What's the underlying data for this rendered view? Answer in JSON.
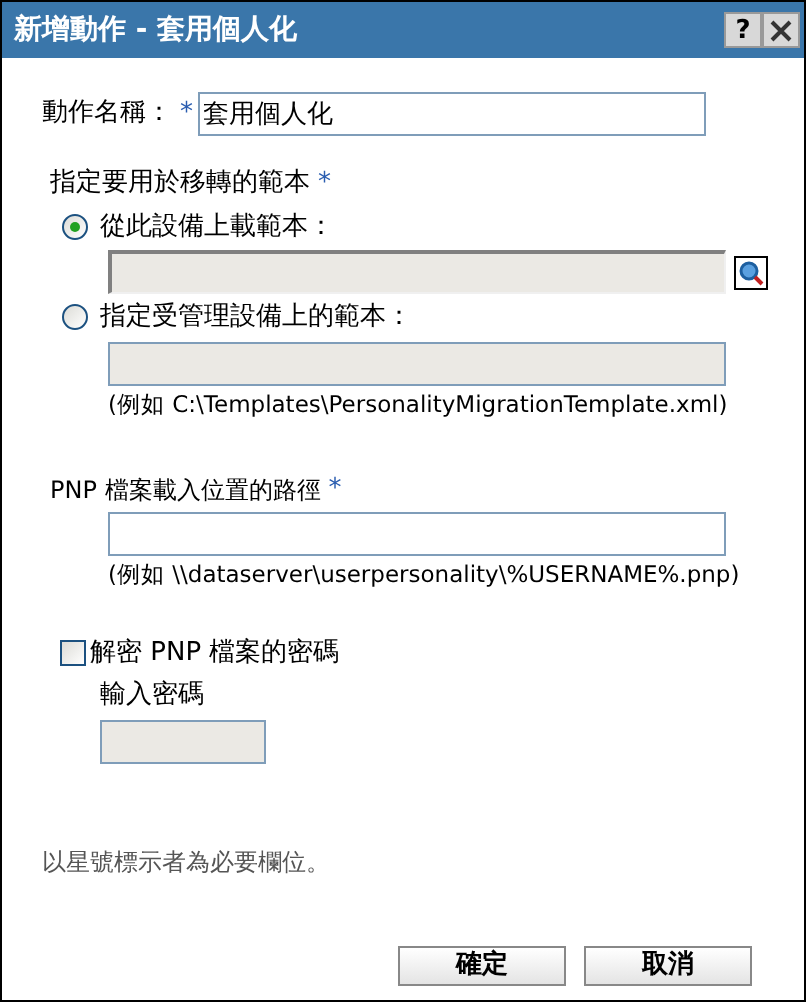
{
  "window": {
    "title": "新增動作 - 套用個人化",
    "help": "?"
  },
  "action_name": {
    "label": "動作名稱：",
    "required_mark": "*",
    "value": "套用個人化"
  },
  "template": {
    "label": "指定要用於移轉的範本",
    "required_mark": "*",
    "options": [
      {
        "kind": "upload",
        "label": "從此設備上載範本：",
        "selected": true,
        "disabled": true
      },
      {
        "kind": "path",
        "label": "指定受管理設備上的範本：",
        "selected": false,
        "disabled": true,
        "hint": "(例如 C:\\Templates\\PersonalityMigrationTemplate.xml)"
      }
    ]
  },
  "pnp_path": {
    "label": "PNP 檔案載入位置的路徑",
    "required_mark": "*",
    "disabled": false,
    "hint": "(例如 \\\\dataserver\\userpersonality\\%USERNAME%.pnp)"
  },
  "decrypt": {
    "label": "解密 PNP 檔案的密碼",
    "checked": false,
    "password_label": "輸入密碼",
    "password_disabled": true
  },
  "required_note": "以星號標示者為必要欄位。",
  "buttons": [
    "確定",
    "取消"
  ]
}
